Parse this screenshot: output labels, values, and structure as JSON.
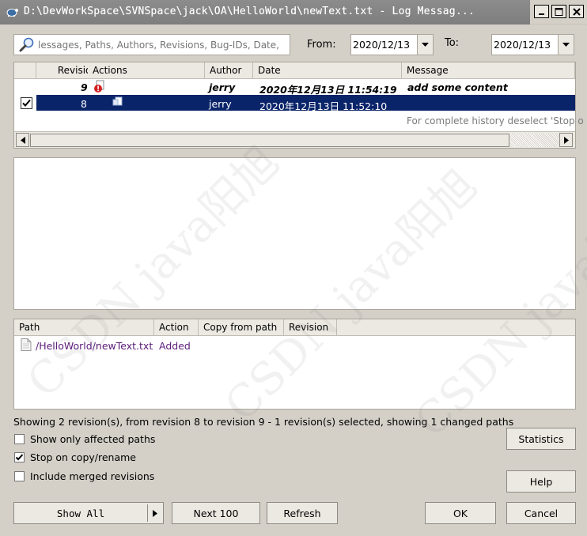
{
  "window": {
    "title": "D:\\DevWorkSpace\\SVNSpace\\jack\\OA\\HelloWorld\\newText.txt - Log Messag..."
  },
  "filter": {
    "search_placeholder": "lessages, Paths, Authors, Revisions, Bug-IDs, Date,",
    "from_label": "From:",
    "from_value": "2020/12/13",
    "to_label": "To:",
    "to_value": "2020/12/13"
  },
  "revisions": {
    "columns": [
      "Revision",
      "Actions",
      "Author",
      "Date",
      "Message"
    ],
    "rows": [
      {
        "revision": "9",
        "author": "jerry",
        "date": "2020年12月13日 11:54:19",
        "message": "add some content",
        "bold": true,
        "checked": false
      },
      {
        "revision": "8",
        "author": "jerry",
        "date": "2020年12月13日 11:52:10",
        "message": "",
        "bold": false,
        "checked": true
      }
    ],
    "hint": "For complete history deselect 'Stop o"
  },
  "paths": {
    "columns": [
      "Path",
      "Action",
      "Copy from path",
      "Revision"
    ],
    "rows": [
      {
        "path": "/HelloWorld/newText.txt",
        "action": "Added"
      }
    ]
  },
  "status": "Showing 2 revision(s), from revision 8 to revision 9 - 1 revision(s) selected, showing 1 changed paths",
  "options": {
    "affected_paths": "Show only affected paths",
    "stop_on_copy": "Stop on copy/rename",
    "merged_revisions": "Include merged revisions"
  },
  "buttons": {
    "statistics": "Statistics",
    "help": "Help",
    "show_all": "Show All",
    "next_100": "Next 100",
    "refresh": "Refresh",
    "ok": "OK",
    "cancel": "Cancel"
  },
  "watermark": "CSDN java阳旭",
  "colors": {
    "selection": "#0a246a",
    "path_link": "#5b1a78",
    "face": "#d4d0c8"
  }
}
